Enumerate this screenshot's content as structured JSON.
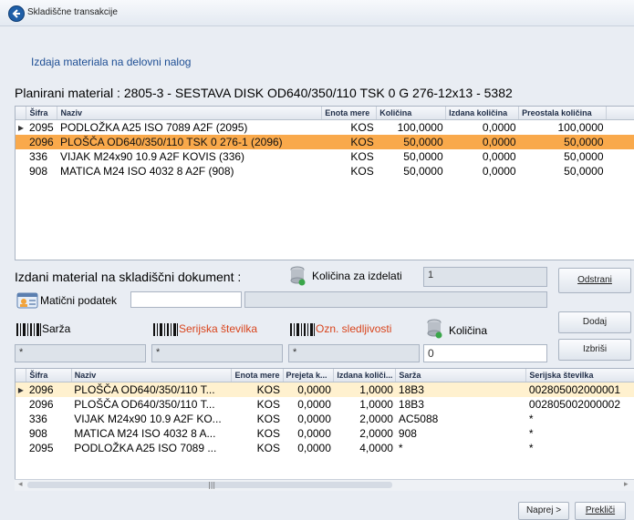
{
  "window": {
    "title": "Skladiščne transakcije"
  },
  "link_text": "Izdaja materiala na delovni nalog",
  "planned_title": "Planirani material : 2805-3 - SESTAVA DISK OD640/350/110 TSK 0 G 276-12x13 - 5382",
  "planned_table": {
    "headers": [
      "Šifra",
      "Naziv",
      "Enota mere",
      "Količina",
      "Izdana količina",
      "Preostala količina"
    ],
    "rows": [
      [
        "2095",
        "PODLOŽKA A25 ISO 7089 A2F (2095)",
        "KOS",
        "100,0000",
        "0,0000",
        "100,0000"
      ],
      [
        "2096",
        "PLOŠČA OD640/350/110 TSK 0 276-1 (2096)",
        "KOS",
        "50,0000",
        "0,0000",
        "50,0000"
      ],
      [
        "336",
        "VIJAK M24x90 10.9 A2F KOVIS (336)",
        "KOS",
        "50,0000",
        "0,0000",
        "50,0000"
      ],
      [
        "908",
        "MATICA M24 ISO 4032 8 A2F (908)",
        "KOS",
        "50,0000",
        "0,0000",
        "50,0000"
      ]
    ]
  },
  "issued_title": "Izdani material na skladiščni dokument :",
  "qty_for_product": {
    "label": "Količina za izdelati",
    "value": "1"
  },
  "master_data": {
    "label": "Matični podatek",
    "value": ""
  },
  "filters": {
    "batch": {
      "label": "Sarža",
      "value": "*"
    },
    "serial": {
      "label": "Serijska številka",
      "value": "*"
    },
    "trace": {
      "label": "Ozn. sledljivosti",
      "value": "*"
    },
    "quantity": {
      "label": "Količina",
      "value": "0"
    }
  },
  "buttons": {
    "remove": "Odstrani",
    "add": "Dodaj",
    "delete": "Izbriši",
    "next": "Naprej >",
    "cancel": "Prekliči"
  },
  "issued_table": {
    "headers": [
      "Šifra",
      "Naziv",
      "Enota mere",
      "Prejeta k...",
      "Izdana količi...",
      "Sarža",
      "Serijska številka"
    ],
    "rows": [
      [
        "2096",
        "PLOŠČA OD640/350/110 T...",
        "KOS",
        "0,0000",
        "1,0000",
        "18B3",
        "002805002000001"
      ],
      [
        "2096",
        "PLOŠČA OD640/350/110 T...",
        "KOS",
        "0,0000",
        "1,0000",
        "18B3",
        "002805002000002"
      ],
      [
        "336",
        "VIJAK M24x90 10.9 A2F KO...",
        "KOS",
        "0,0000",
        "2,0000",
        "AC5088",
        "*"
      ],
      [
        "908",
        "MATICA M24 ISO 4032 8 A...",
        "KOS",
        "0,0000",
        "2,0000",
        "908",
        "*"
      ],
      [
        "2095",
        "PODLOŽKA A25 ISO 7089 ...",
        "KOS",
        "0,0000",
        "4,0000",
        "*",
        "*"
      ]
    ]
  },
  "colors": {
    "selected_row": "#f9a94b",
    "accent_red": "#d9441c",
    "link": "#1f4f94"
  }
}
